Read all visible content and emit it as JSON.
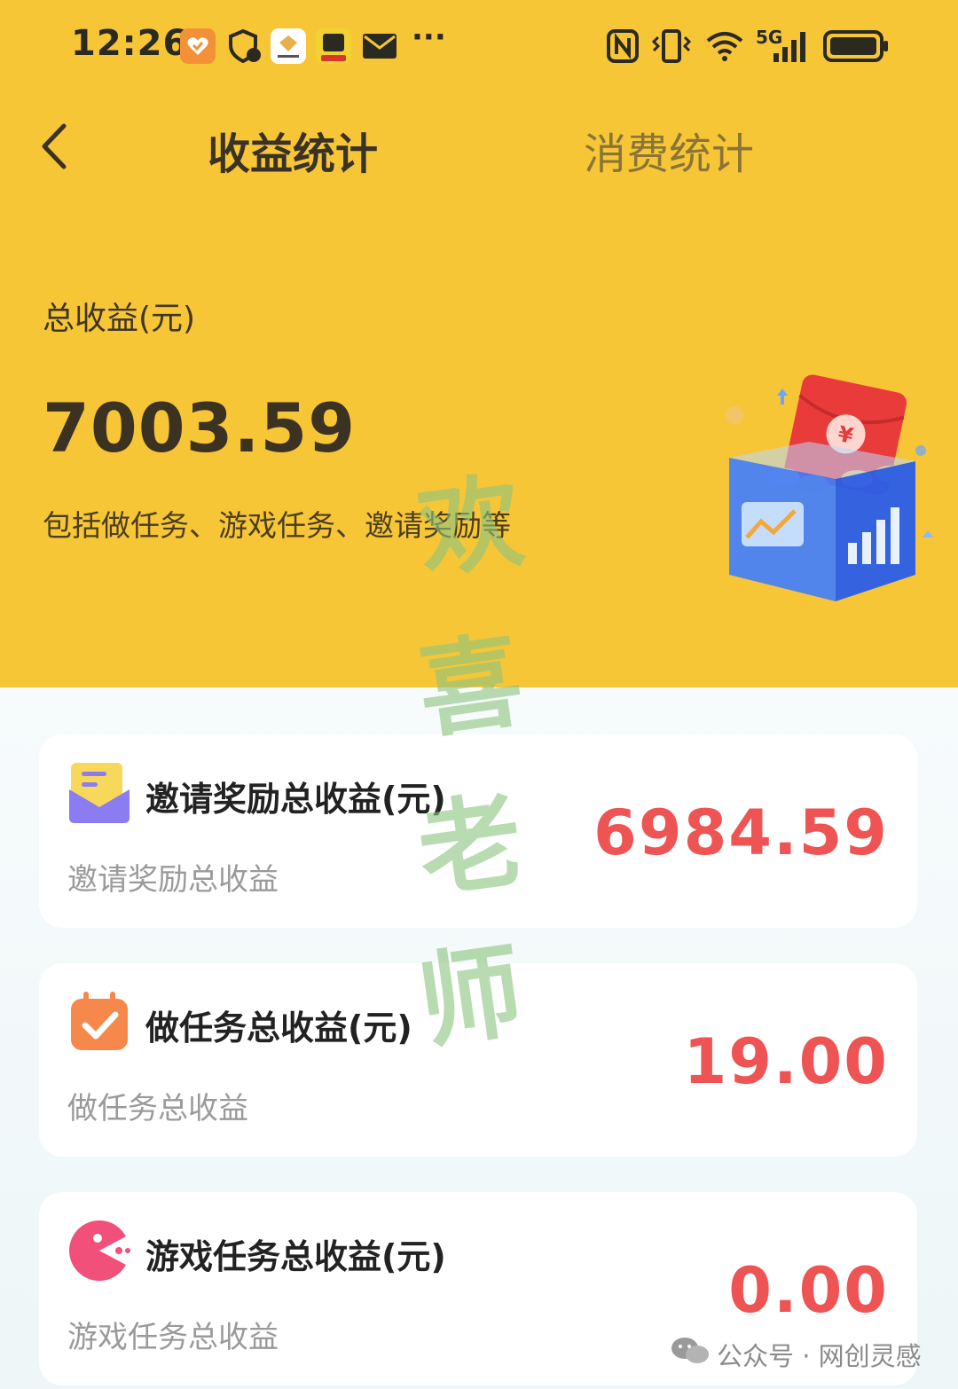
{
  "status_bar": {
    "time": "12:26",
    "overflow": "···",
    "network_label": "5G",
    "icons": [
      "heart-app-icon",
      "shield-notification-icon",
      "honor-app-icon",
      "qu-app-icon",
      "mail-icon",
      "nfc-icon",
      "vibrate-icon",
      "wifi-icon",
      "cellular-signal-icon",
      "battery-icon"
    ]
  },
  "nav": {
    "tabs": [
      {
        "label": "收益统计",
        "active": true
      },
      {
        "label": "消费统计",
        "active": false
      }
    ]
  },
  "summary": {
    "label": "总收益(元)",
    "value": "7003.59",
    "description": "包括做任务、游戏任务、邀请奖励等"
  },
  "cards": [
    {
      "title": "邀请奖励总收益(元)",
      "subtitle": "邀请奖励总收益",
      "amount": "6984.59",
      "icon": "envelope-icon"
    },
    {
      "title": "做任务总收益(元)",
      "subtitle": "做任务总收益",
      "amount": "19.00",
      "icon": "calendar-check-icon"
    },
    {
      "title": "游戏任务总收益(元)",
      "subtitle": "游戏任务总收益",
      "amount": "0.00",
      "icon": "game-pacman-icon"
    }
  ],
  "watermark": {
    "chars": [
      "欢",
      "喜",
      "老",
      "师"
    ]
  },
  "footer": {
    "text": "公众号 · 网创灵感"
  },
  "colors": {
    "header_bg": "#f7c637",
    "amount_red": "#ee5454",
    "page_bg": "#f3f8f9"
  }
}
